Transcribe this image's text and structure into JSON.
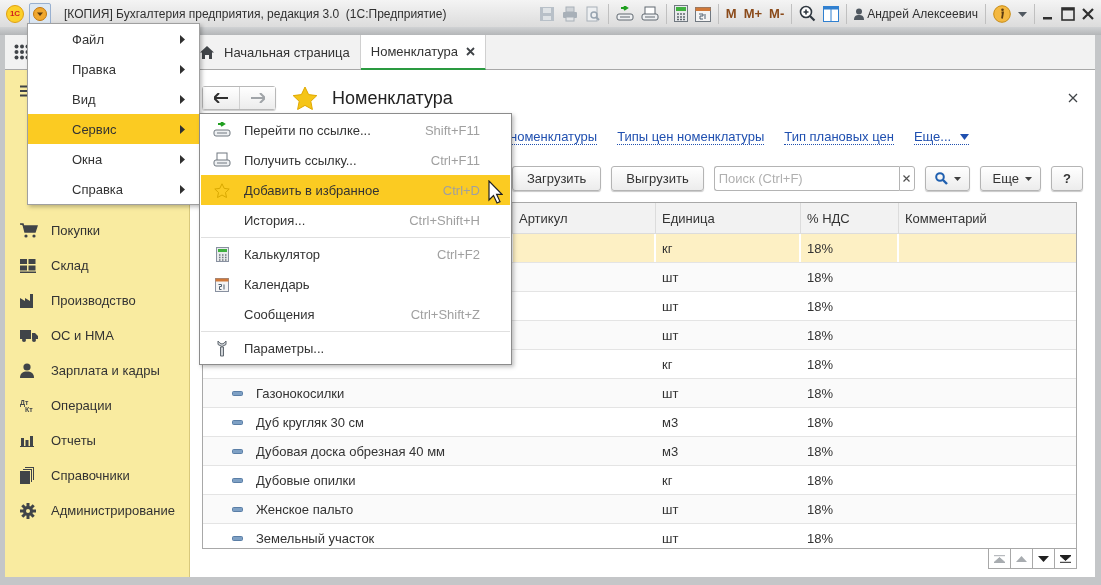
{
  "window": {
    "logo": "1С",
    "title": "[КОПИЯ] Бухгалтерия предприятия, редакция 3.0  (1С:Предприятие)",
    "memory_buttons": [
      "M",
      "M+",
      "M-"
    ],
    "user": "Андрей Алексеевич"
  },
  "tabs": [
    {
      "label": "Начальная страница",
      "selected": false,
      "kind": "home"
    },
    {
      "label": "Номенклатура",
      "selected": true,
      "closable": true
    }
  ],
  "sidebar": {
    "items": [
      {
        "label": "Покупки",
        "kind": "cart"
      },
      {
        "label": "Склад",
        "kind": "warehouse"
      },
      {
        "label": "Производство",
        "kind": "factory"
      },
      {
        "label": "ОС и НМА",
        "kind": "truck"
      },
      {
        "label": "Зарплата и кадры",
        "kind": "person"
      },
      {
        "label": "Операции",
        "kind": "dtkt",
        "icon_text": [
          "Дт",
          "Кт"
        ]
      },
      {
        "label": "Отчеты",
        "kind": "bars"
      },
      {
        "label": "Справочники",
        "kind": "books"
      },
      {
        "label": "Администрирование",
        "kind": "gear"
      }
    ]
  },
  "form": {
    "title": "Номенклатура",
    "favorite": true,
    "links": [
      {
        "label": "номенклатуры",
        "kind": "link"
      },
      {
        "label": "Типы цен номенклатуры",
        "kind": "link"
      },
      {
        "label": "Тип плановых цен",
        "kind": "link"
      },
      {
        "label": "Еще...",
        "kind": "more"
      }
    ],
    "toolbar": {
      "buttons": [
        "Загрузить",
        "Выгрузить"
      ],
      "search": {
        "placeholder": "Поиск (Ctrl+F)"
      },
      "more": "Еще",
      "help": "?"
    }
  },
  "table": {
    "columns": [
      "Артикул",
      "Единица",
      "% НДС",
      "Комментарий"
    ],
    "rows": [
      {
        "unit": "кг",
        "vat": "18%",
        "selected": true
      },
      {
        "unit": "шт",
        "vat": "18%",
        "selected": false
      },
      {
        "unit": "шт",
        "vat": "18%",
        "selected": false
      },
      {
        "unit": "шт",
        "vat": "18%",
        "selected": false
      },
      {
        "unit": "кг",
        "vat": "18%",
        "selected": false
      },
      {
        "name": "Газонокосилки",
        "marker": true,
        "unit": "шт",
        "vat": "18%",
        "selected": false
      },
      {
        "name": "Дуб кругляк 30 см",
        "marker": true,
        "unit": "м3",
        "vat": "18%",
        "selected": false
      },
      {
        "name": "Дубовая доска обрезная 40 мм",
        "marker": true,
        "unit": "м3",
        "vat": "18%",
        "selected": false
      },
      {
        "name": "Дубовые опилки",
        "marker": true,
        "unit": "кг",
        "vat": "18%",
        "selected": false
      },
      {
        "name": "Женское пальто",
        "marker": true,
        "unit": "шт",
        "vat": "18%",
        "selected": false
      },
      {
        "name": "Земельный участок",
        "marker": true,
        "unit": "шт",
        "vat": "18%",
        "selected": false
      }
    ]
  },
  "main_menu": {
    "items": [
      {
        "label": "Файл",
        "selected": false,
        "submenu": true
      },
      {
        "label": "Правка",
        "selected": false,
        "submenu": true
      },
      {
        "label": "Вид",
        "selected": false,
        "submenu": true
      },
      {
        "label": "Сервис",
        "selected": true,
        "submenu": true
      },
      {
        "label": "Окна",
        "selected": false,
        "submenu": true
      },
      {
        "label": "Справка",
        "selected": false,
        "submenu": true
      }
    ]
  },
  "service_submenu": {
    "groups": [
      [
        {
          "label": "Перейти по ссылке...",
          "shortcut": "Shift+F11",
          "selected": false,
          "kind": "link-go"
        },
        {
          "label": "Получить ссылку...",
          "shortcut": "Ctrl+F11",
          "selected": false,
          "kind": "link-get"
        },
        {
          "label": "Добавить в избранное",
          "shortcut": "Ctrl+D",
          "selected": true,
          "kind": "star"
        },
        {
          "label": "История...",
          "shortcut": "Ctrl+Shift+H",
          "selected": false,
          "kind": "plain"
        }
      ],
      [
        {
          "label": "Калькулятор",
          "shortcut": "Ctrl+F2",
          "selected": false,
          "kind": "calculator"
        },
        {
          "label": "Календарь",
          "selected": false,
          "kind": "calendar"
        },
        {
          "label": "Сообщения",
          "shortcut": "Ctrl+Shift+Z",
          "selected": false,
          "kind": "plain"
        }
      ],
      [
        {
          "label": "Параметры...",
          "selected": false,
          "kind": "wrench"
        }
      ]
    ]
  }
}
